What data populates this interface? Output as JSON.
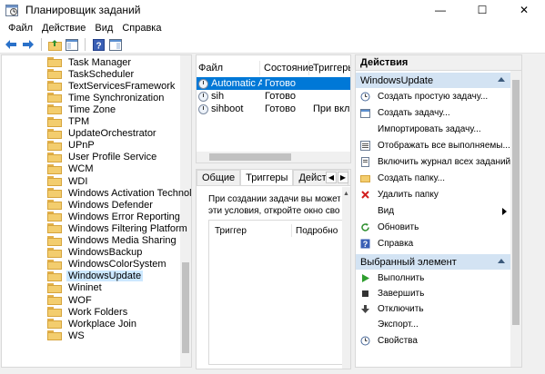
{
  "window": {
    "title": "Планировщик заданий",
    "buttons": {
      "minimize": "—",
      "maximize": "☐",
      "close": "✕"
    }
  },
  "menu": [
    "Файл",
    "Действие",
    "Вид",
    "Справка"
  ],
  "toolbar": [
    "back-arrow-icon",
    "forward-arrow-icon",
    "folder-up-icon",
    "show-hide-pane-icon",
    "help-icon",
    "properties-pane-icon"
  ],
  "tree": {
    "items": [
      "Task Manager",
      "TaskScheduler",
      "TextServicesFramework",
      "Time Synchronization",
      "Time Zone",
      "TPM",
      "UpdateOrchestrator",
      "UPnP",
      "User Profile Service",
      "WCM",
      "WDI",
      "Windows Activation Technolog",
      "Windows Defender",
      "Windows Error Reporting",
      "Windows Filtering Platform",
      "Windows Media Sharing",
      "WindowsBackup",
      "WindowsColorSystem",
      "WindowsUpdate",
      "Wininet",
      "WOF",
      "Work Folders",
      "Workplace Join",
      "WS"
    ],
    "selected": "WindowsUpdate"
  },
  "tasks": {
    "columns": [
      "Файл",
      "Состояние",
      "Триггеры"
    ],
    "rows": [
      {
        "name": "Automatic A...",
        "status": "Готово",
        "trigger": ""
      },
      {
        "name": "sih",
        "status": "Готово",
        "trigger": ""
      },
      {
        "name": "sihboot",
        "status": "Готово",
        "trigger": "При вклю"
      }
    ]
  },
  "details": {
    "tabs": [
      "Общие",
      "Триггеры",
      "Действия"
    ],
    "active_tab": "Триггеры",
    "info_line1": "При создании задачи вы можете у",
    "info_line2": "эти условия, откройте окно свойс",
    "trigger_columns": [
      "Триггер",
      "Подробно"
    ]
  },
  "actions": {
    "title": "Действия",
    "section1": "WindowsUpdate",
    "items1": [
      {
        "label": "Создать простую задачу...",
        "icon": "create-basic-task-icon"
      },
      {
        "label": "Создать задачу...",
        "icon": "create-task-icon"
      },
      {
        "label": "Импортировать задачу...",
        "icon": ""
      },
      {
        "label": "Отображать все выполняемы...",
        "icon": "running-tasks-icon"
      },
      {
        "label": "Включить журнал всех заданий",
        "icon": "history-icon"
      },
      {
        "label": "Создать папку...",
        "icon": "new-folder-icon"
      },
      {
        "label": "Удалить папку",
        "icon": "delete-icon"
      },
      {
        "label": "Вид",
        "icon": ""
      },
      {
        "label": "Обновить",
        "icon": "refresh-icon"
      },
      {
        "label": "Справка",
        "icon": "help-icon"
      }
    ],
    "section2": "Выбранный элемент",
    "items2": [
      {
        "label": "Выполнить",
        "icon": "run-icon"
      },
      {
        "label": "Завершить",
        "icon": "stop-icon"
      },
      {
        "label": "Отключить",
        "icon": "disable-icon"
      },
      {
        "label": "Экспорт...",
        "icon": ""
      },
      {
        "label": "Свойства",
        "icon": "properties-icon"
      }
    ]
  },
  "colors": {
    "selection_blue": "#0078d7",
    "section_header": "#d3e3f3",
    "tree_selection": "#cce8ff"
  }
}
